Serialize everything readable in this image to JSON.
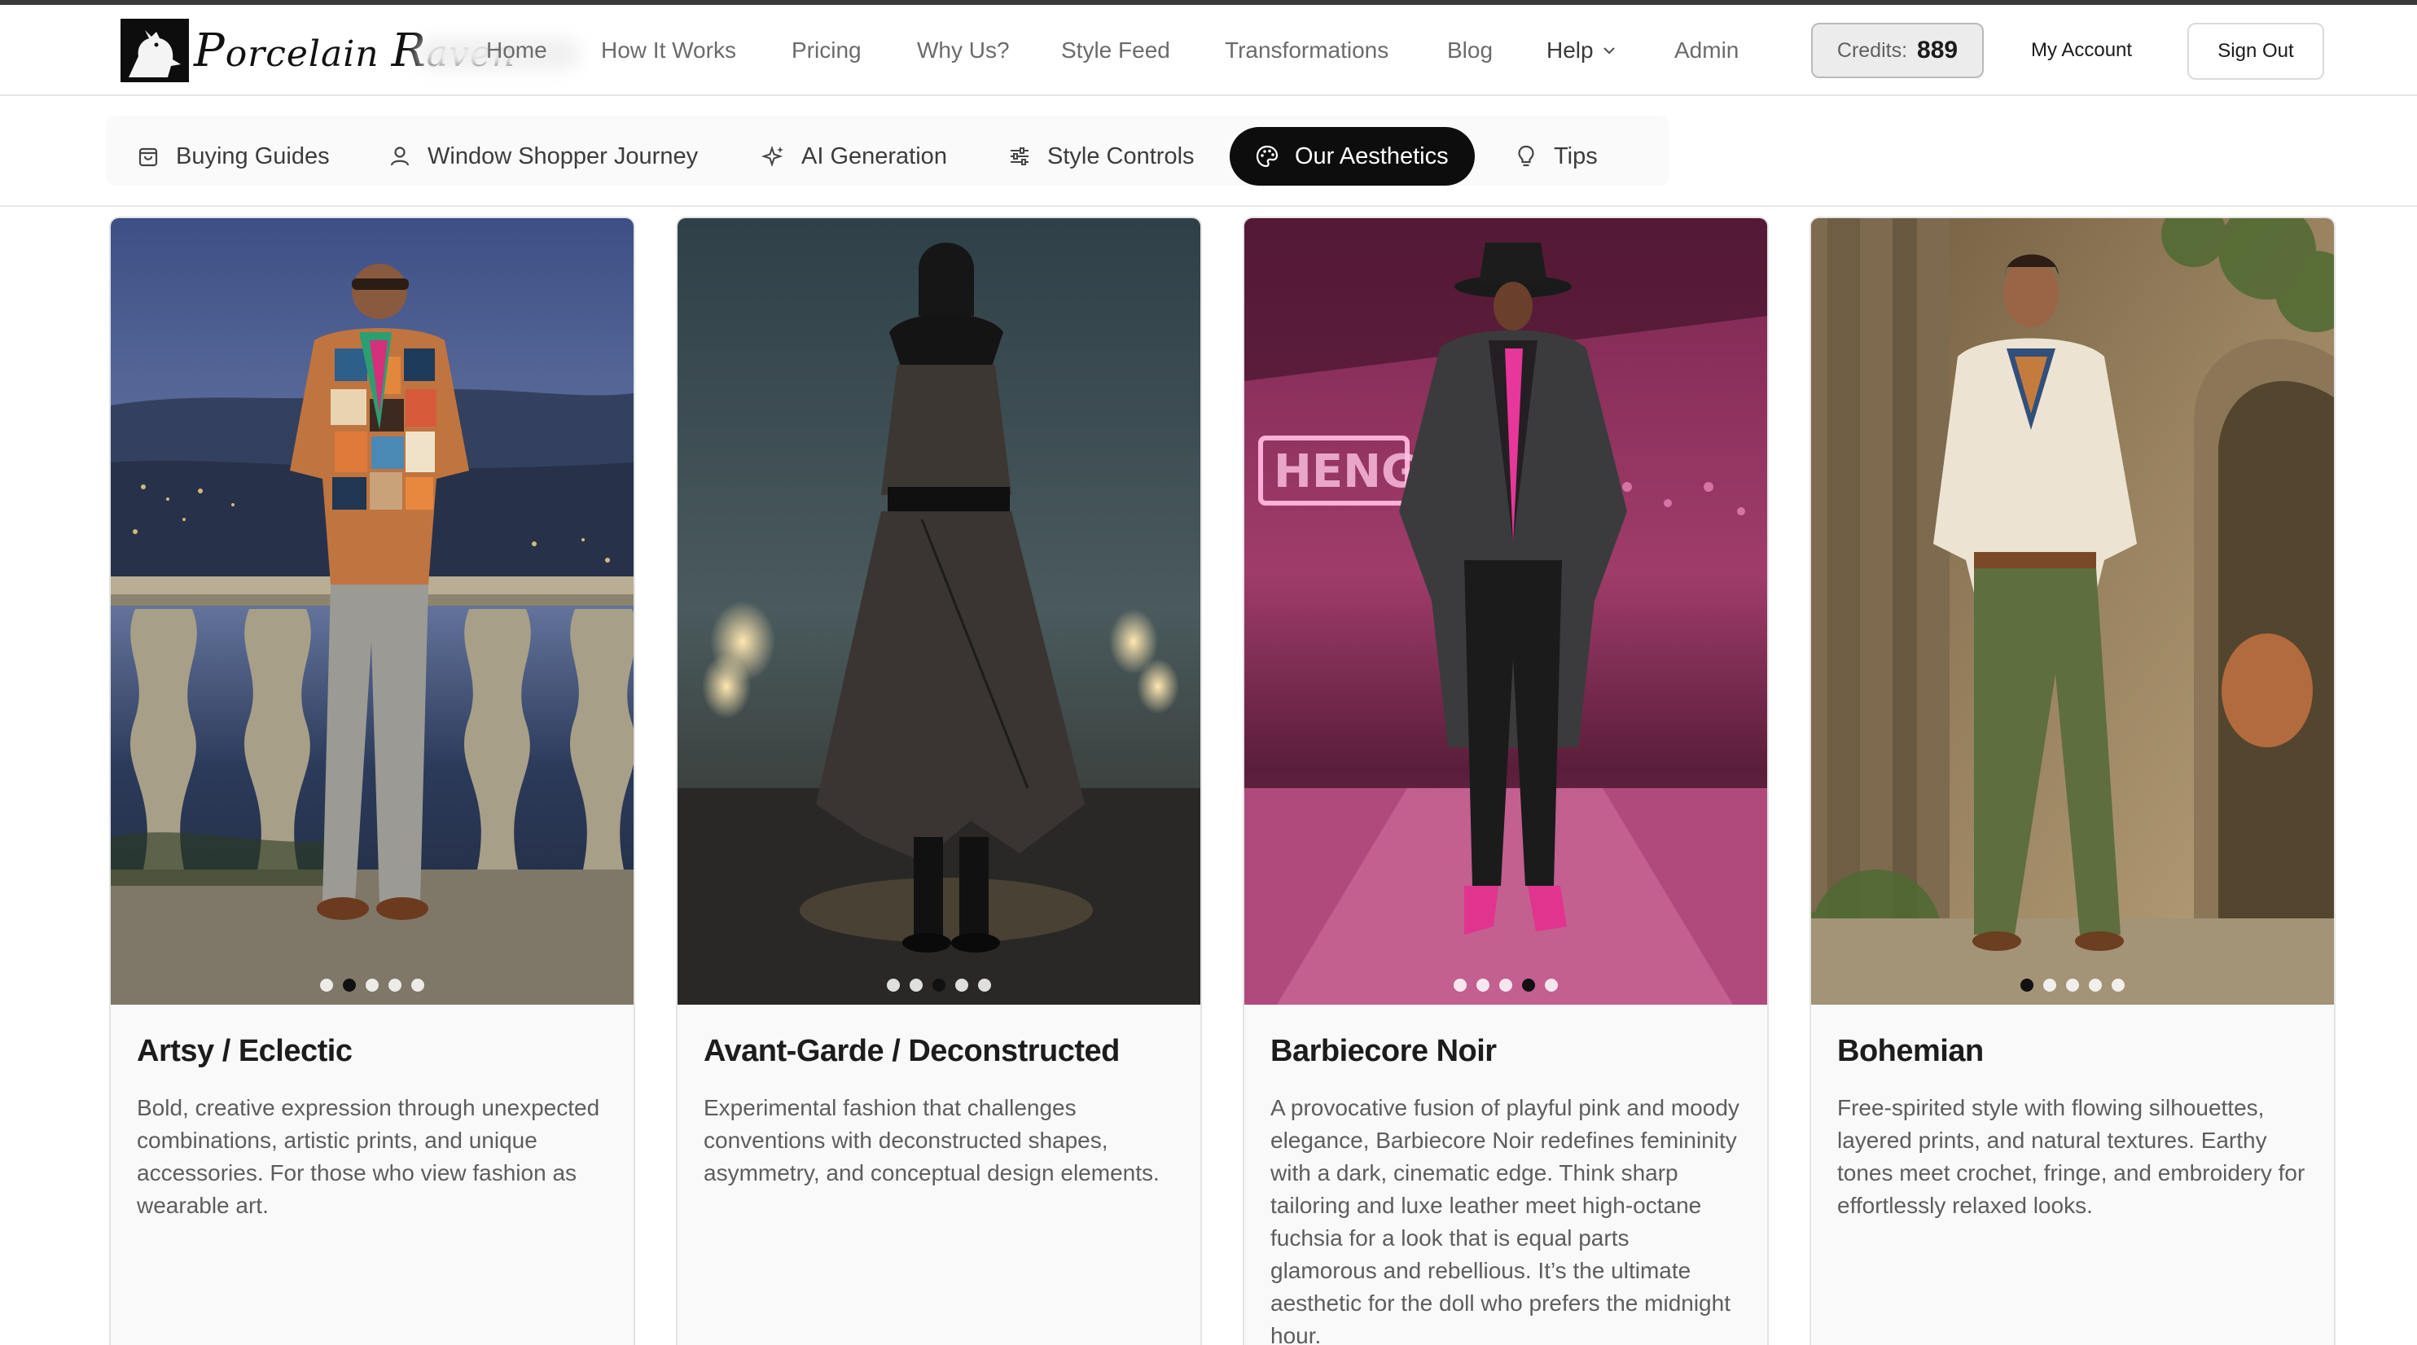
{
  "brand": {
    "logo_text": "Porcelain Raven"
  },
  "topnav": {
    "links": [
      {
        "label": "Home"
      },
      {
        "label": "How It Works"
      },
      {
        "label": "Pricing"
      },
      {
        "label": "Why Us?"
      },
      {
        "label": "Style Feed"
      },
      {
        "label": "Transformations"
      },
      {
        "label": "Blog"
      },
      {
        "label": "Help"
      },
      {
        "label": "Admin"
      }
    ],
    "credits_label": "Credits:",
    "credits_value": "889",
    "my_account": "My Account",
    "sign_out": "Sign Out"
  },
  "subnav": {
    "tabs": [
      {
        "label": "Buying Guides",
        "icon": "bag-icon"
      },
      {
        "label": "Window Shopper Journey",
        "icon": "user-icon"
      },
      {
        "label": "AI Generation",
        "icon": "sparkles-icon"
      },
      {
        "label": "Style Controls",
        "icon": "sliders-icon"
      },
      {
        "label": "Our Aesthetics",
        "icon": "palette-icon",
        "active": true
      },
      {
        "label": "Tips",
        "icon": "lightbulb-icon"
      }
    ]
  },
  "aesthetics": [
    {
      "title": "Artsy / Eclectic",
      "description": "Bold, creative expression through unexpected combinations, artistic prints, and unique accessories. For those who view fashion as wearable art.",
      "active_slide": 1
    },
    {
      "title": "Avant-Garde / Deconstructed",
      "description": "Experimental fashion that challenges conventions with deconstructed shapes, asymmetry, and conceptual design elements.",
      "active_slide": 2
    },
    {
      "title": "Barbiecore Noir",
      "description": "A provocative fusion of playful pink and moody elegance, Barbiecore Noir redefines femininity with a dark, cinematic edge. Think sharp tailoring and luxe leather meet high-octane fuchsia for a look that is equal parts glamorous and rebellious. It’s the ultimate aesthetic for the doll who prefers the midnight hour.",
      "active_slide": 3
    },
    {
      "title": "Bohemian",
      "description": "Free-spirited style with flowing silhouettes, layered prints, and natural textures. Earthy tones meet crochet, fringe, and embroidery for effortlessly relaxed looks.",
      "active_slide": 0
    }
  ],
  "colors": {
    "active_tab": "#0d0d0d",
    "accent_pink": "#e0348f"
  }
}
